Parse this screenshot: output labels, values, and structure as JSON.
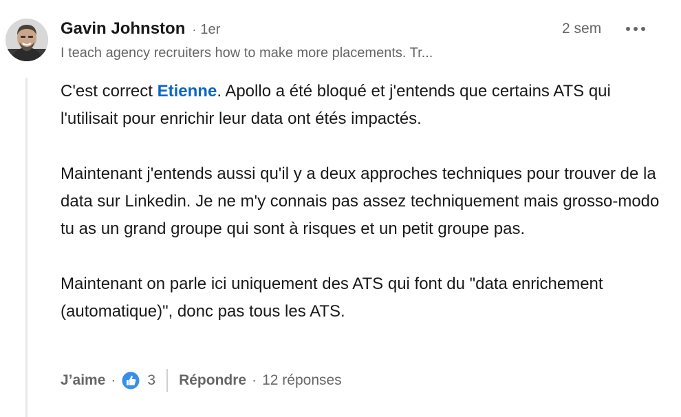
{
  "comment": {
    "author": {
      "name": "Gavin Johnston",
      "degree": "1er",
      "headline": "I teach agency recruiters how to make more placements. Tr..."
    },
    "time": "2 sem",
    "body": {
      "p1_before": "C'est correct ",
      "mention": "Etienne",
      "p1_after": ". Apollo a été bloqué et j'entends que certains ATS qui l'utilisait pour enrichir leur data ont étés impactés.",
      "p2": "Maintenant j'entends aussi qu'il y a deux approches techniques pour trouver de la data sur Linkedin. Je ne m'y connais pas assez techniquement mais grosso-modo tu as un grand groupe qui sont à risques et un petit groupe pas.",
      "p3": "Maintenant on parle ici uniquement des ATS qui font du \"data enrichement (automatique)\", donc pas tous les ATS."
    },
    "actions": {
      "like_label": "J’aime",
      "reaction_count": "3",
      "reply_label": "Répondre",
      "replies_count": "12 réponses",
      "dot": "·"
    }
  },
  "colors": {
    "accent": "#0a66c2",
    "muted": "#666666",
    "thread_line": "#e8e8e8"
  },
  "icons": [
    "more-options-icon",
    "like-reaction-icon"
  ]
}
